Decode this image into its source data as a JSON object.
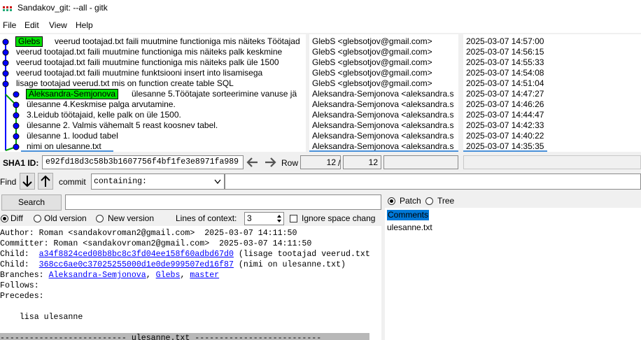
{
  "window": {
    "title": "Sandakov_git: --all - gitk"
  },
  "menu": [
    "File",
    "Edit",
    "View",
    "Help"
  ],
  "commits": [
    {
      "ref": "Glebs",
      "subject": "veerud tootajad.txt faili muutmine functioniga mis näiteks Töötajad",
      "author": "GlebS <glebsotjov@gmail.com>",
      "date": "2025-03-07 14:57:00"
    },
    {
      "subject": "veerud tootajad.txt faili muutmine functioniga mis näiteks palk keskmine",
      "author": "GlebS <glebsotjov@gmail.com>",
      "date": "2025-03-07 14:56:15"
    },
    {
      "subject": "veerud tootajad.txt faili muutmine functioniga mis näiteks palk üle 1500",
      "author": "GlebS <glebsotjov@gmail.com>",
      "date": "2025-03-07 14:55:33"
    },
    {
      "subject": "veerud tootajad.txt faili muutmine funktsiooni insert into lisamisega",
      "author": "GlebS <glebsotjov@gmail.com>",
      "date": "2025-03-07 14:54:08"
    },
    {
      "subject": "lisage tootajad veerud.txt mis on function create table SQL",
      "author": "GlebS <glebsotjov@gmail.com>",
      "date": "2025-03-07 14:51:04"
    },
    {
      "ref": "Aleksandra-Semjonova",
      "subject": "ülesanne 5.Töötajate sorteerimine vanuse jä",
      "author": "Aleksandra-Semjonova <aleksandra.s",
      "date": "2025-03-07 14:47:27"
    },
    {
      "subject": "ülesanne 4.Keskmise palga arvutamine.",
      "author": "Aleksandra-Semjonova <aleksandra.s",
      "date": "2025-03-07 14:46:26"
    },
    {
      "subject": "3.Leidub töötajaid, kelle palk on üle 1500.",
      "author": "Aleksandra-Semjonova <aleksandra.s",
      "date": "2025-03-07 14:44:47"
    },
    {
      "subject": "ülesanne 2. Valmis vähemalt 5 reast koosnev tabel.",
      "author": "Aleksandra-Semjonova <aleksandra.s",
      "date": "2025-03-07 14:42:33"
    },
    {
      "subject": "ülesanne 1. loodud tabel",
      "author": "Aleksandra-Semjonova <aleksandra.s",
      "date": "2025-03-07 14:40:22"
    },
    {
      "subject": "nimi on ulesanne.txt",
      "author": "Aleksandra-Semjonova <aleksandra.s",
      "date": "2025-03-07 14:35:35"
    }
  ],
  "sha": {
    "label": "SHA1 ID:",
    "value": "e92fd18d3c58b3b1607756f4bf1fe3e8971fa989"
  },
  "row": {
    "label": "Row",
    "current": "12",
    "sep": "/",
    "total": "12"
  },
  "find": {
    "label": "Find",
    "type": "commit",
    "mode": "containing:"
  },
  "search": {
    "button": "Search"
  },
  "diff_options": {
    "diff": "Diff",
    "old": "Old version",
    "new": "New version",
    "context_label": "Lines of context:",
    "context_value": "3",
    "ignore_space": "Ignore space chang"
  },
  "view_options": {
    "patch": "Patch",
    "tree": "Tree"
  },
  "details": {
    "author": "Author: Roman <sandakovroman2@gmail.com>  2025-03-07 14:11:50",
    "committer": "Committer: Roman <sandakovroman2@gmail.com>  2025-03-07 14:11:50",
    "child1_label": "Child:  ",
    "child1_hash": "a34f8824ced08b8bc8c3fd04ee158f60adbd67d0",
    "child1_desc": " (lisage tootajad veerud.txt",
    "child2_label": "Child:  ",
    "child2_hash": "368cc6ae0c37025255000d1e0de999507ed16f87",
    "child2_desc": " (nimi on ulesanne.txt)",
    "branches_label": "Branches: ",
    "branch1": "Aleksandra-Semjonova",
    "branch2": "Glebs",
    "branch3": "master",
    "follows": "Follows:",
    "precedes": "Precedes:",
    "message": "    lisa ulesanne",
    "file_header": "-------------------------- ulesanne.txt --------------------------"
  },
  "files": {
    "comments": "Comments",
    "items": [
      "ulesanne.txt"
    ]
  }
}
